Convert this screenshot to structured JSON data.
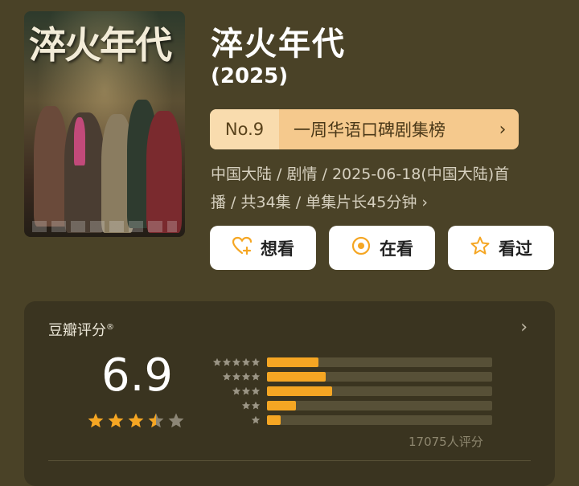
{
  "poster": {
    "title_text": "淬火年代",
    "icon": "drama-poster"
  },
  "title": "淬火年代",
  "year": "(2025)",
  "ranking": {
    "rank": "No.9",
    "list_name": "一周华语口碑剧集榜",
    "chevron": "›"
  },
  "meta": {
    "line1": "中国大陆 / 剧情 / 2025-06-18(中国大陆)首",
    "line2": "播 / 共34集 / 单集片长45分钟",
    "chevron": "›"
  },
  "actions": [
    {
      "label": "想看",
      "icon": "heart-plus-icon"
    },
    {
      "label": "在看",
      "icon": "target-icon"
    },
    {
      "label": "看过",
      "icon": "star-outline-icon"
    }
  ],
  "rating": {
    "label": "豆瓣评分",
    "mark": "®",
    "chevron": "›",
    "score": "6.9",
    "stars_filled": 3.5,
    "stars_total": 5,
    "distribution": [
      {
        "stars": 5,
        "fraction": 0.23
      },
      {
        "stars": 4,
        "fraction": 0.26
      },
      {
        "stars": 3,
        "fraction": 0.29
      },
      {
        "stars": 2,
        "fraction": 0.13
      },
      {
        "stars": 1,
        "fraction": 0.06
      }
    ],
    "count_text": "17075人评分"
  },
  "colors": {
    "background": "#4a4227",
    "card": "#3a3420",
    "accent": "#f5a623",
    "rank_badge": "#f5c98d"
  }
}
